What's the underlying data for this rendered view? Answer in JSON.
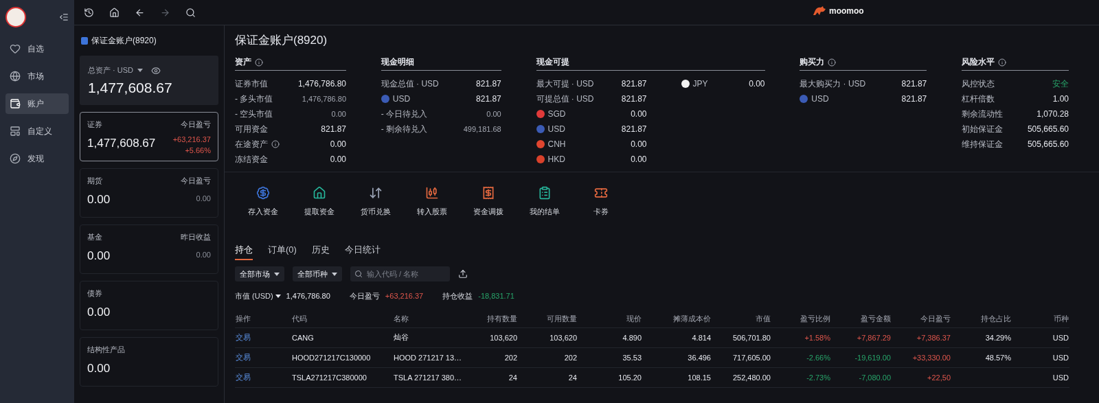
{
  "nav": {
    "items": [
      {
        "label": "自选",
        "selected": false
      },
      {
        "label": "市场",
        "selected": false
      },
      {
        "label": "账户",
        "selected": true
      },
      {
        "label": "自定义",
        "selected": false
      },
      {
        "label": "发现",
        "selected": false
      }
    ]
  },
  "topbar": {
    "logo": "moomoo"
  },
  "account_panel": {
    "title": "保证金账户(8920)",
    "total": {
      "label": "总资产 · USD",
      "value": "1,477,608.67"
    },
    "cards": [
      {
        "label": "证券",
        "value": "1,477,608.67",
        "pl_label": "今日盈亏",
        "pl_values": [
          {
            "text": "+63,216.37",
            "color": "#e0564c"
          },
          {
            "text": "+5.66%",
            "color": "#e0564c"
          }
        ],
        "selected": true
      },
      {
        "label": "期货",
        "value": "0.00",
        "pl_label": "今日盈亏",
        "pl_values": [
          {
            "text": "0.00",
            "color": "#8b8f99"
          }
        ],
        "selected": false
      },
      {
        "label": "基金",
        "value": "0.00",
        "pl_label": "昨日收益",
        "pl_values": [
          {
            "text": "0.00",
            "color": "#8b8f99"
          }
        ],
        "selected": false
      },
      {
        "label": "债券",
        "value": "0.00",
        "selected": false
      },
      {
        "label": "结构性产品",
        "value": "0.00",
        "selected": false
      }
    ]
  },
  "main": {
    "title": "保证金账户(8920)",
    "sections": [
      {
        "title": "资产",
        "info": true,
        "columns": [
          [
            {
              "label": "证券市值",
              "value": "1,476,786.80",
              "kind": "main"
            },
            {
              "label": "- 多头市值",
              "value": "1,476,786.80",
              "kind": "sub"
            },
            {
              "label": "- 空头市值",
              "value": "0.00",
              "kind": "sub"
            },
            {
              "label": "可用资金",
              "value": "821.87",
              "kind": "main"
            },
            {
              "label": "在途资产",
              "value": "0.00",
              "kind": "main",
              "info": true
            },
            {
              "label": "冻结资金",
              "value": "0.00",
              "kind": "main"
            }
          ]
        ]
      },
      {
        "title": "现金明细",
        "columns": [
          [
            {
              "label": "现金总值 · USD",
              "value": "821.87",
              "kind": "main"
            },
            {
              "label": "USD",
              "value": "821.87",
              "kind": "flag",
              "color": "#3b5bb5"
            },
            {
              "label": "- 今日待兑入",
              "value": "0.00",
              "kind": "sub"
            },
            {
              "label": "- 剩余待兑入",
              "value": "499,181.68",
              "kind": "sub"
            }
          ]
        ]
      },
      {
        "title": "现金可提",
        "columns": [
          [
            {
              "label": "最大可提 · USD",
              "value": "821.87",
              "kind": "main"
            },
            {
              "label": "可提总值 · USD",
              "value": "821.87",
              "kind": "main"
            },
            {
              "label": "SGD",
              "value": "0.00",
              "kind": "flag",
              "color": "#e03a3a"
            },
            {
              "label": "USD",
              "value": "821.87",
              "kind": "flag",
              "color": "#3b5bb5"
            },
            {
              "label": "CNH",
              "value": "0.00",
              "kind": "flag",
              "color": "#e0452f"
            },
            {
              "label": "HKD",
              "value": "0.00",
              "kind": "flag",
              "color": "#d9412b"
            }
          ],
          [
            {
              "label": "JPY",
              "value": "0.00",
              "kind": "flag",
              "color": "#f2f2f2"
            }
          ]
        ]
      },
      {
        "title": "购买力",
        "info": true,
        "columns": [
          [
            {
              "label": "最大购买力 · USD",
              "value": "821.87",
              "kind": "main"
            },
            {
              "label": "USD",
              "value": "821.87",
              "kind": "flag",
              "color": "#3b5bb5"
            }
          ]
        ]
      },
      {
        "title": "风险水平",
        "info": true,
        "columns": [
          [
            {
              "label": "风控状态",
              "value": "安全",
              "kind": "status",
              "color": "#27a56a"
            },
            {
              "label": "杠杆倍数",
              "value": "1.00",
              "kind": "main"
            },
            {
              "label": "剩余流动性",
              "value": "1,070.28",
              "kind": "main"
            },
            {
              "label": "初始保证金",
              "value": "505,665.60",
              "kind": "main"
            },
            {
              "label": "维持保证金",
              "value": "505,665.60",
              "kind": "main"
            }
          ]
        ]
      }
    ],
    "actions": [
      {
        "label": "存入资金",
        "color": "#3d74d9"
      },
      {
        "label": "提取资金",
        "color": "#26b59a"
      },
      {
        "label": "货币兑换",
        "color": "#9aa3b5"
      },
      {
        "label": "转入股票",
        "color": "#e3683f"
      },
      {
        "label": "资金调拨",
        "color": "#e3683f"
      },
      {
        "label": "我的结单",
        "color": "#26b59a"
      },
      {
        "label": "卡券",
        "color": "#e3683f"
      }
    ],
    "tabs": [
      {
        "label": "持仓",
        "selected": true
      },
      {
        "label": "订单(0)",
        "selected": false
      },
      {
        "label": "历史",
        "selected": false
      },
      {
        "label": "今日统计",
        "selected": false
      }
    ],
    "filters": {
      "dropdowns": [
        "全部市场",
        "全部币种"
      ],
      "search": {
        "placeholder": "输入代码 / 名称"
      }
    },
    "summary": [
      {
        "label": "市值 (USD)",
        "value": "1,476,786.80",
        "dropdown": true
      },
      {
        "label": "今日盈亏",
        "value": "+63,216.37",
        "color": "#e0564c"
      },
      {
        "label": "持仓收益",
        "value": "-18,831.71",
        "color": "#27a56a"
      }
    ],
    "table": {
      "columns": [
        "操作",
        "代码",
        "名称",
        "持有数量",
        "可用数量",
        "现价",
        "摊薄成本价",
        "市值",
        "盈亏比例",
        "盈亏金额",
        "今日盈亏",
        "持仓占比",
        "币种"
      ],
      "rows": [
        [
          {
            "text": "交易",
            "kind": "link"
          },
          {
            "text": "CANG"
          },
          {
            "text": "灿谷"
          },
          {
            "text": "103,620"
          },
          {
            "text": "103,620"
          },
          {
            "text": "4.890"
          },
          {
            "text": "4.814"
          },
          {
            "text": "506,701.80"
          },
          {
            "text": "+1.58%",
            "color": "#e0564c"
          },
          {
            "text": "+7,867.29",
            "color": "#e0564c"
          },
          {
            "text": "+7,386.37",
            "color": "#e0564c"
          },
          {
            "text": "34.29%"
          },
          {
            "text": "USD"
          }
        ],
        [
          {
            "text": "交易",
            "kind": "link"
          },
          {
            "text": "HOOD271217C130000"
          },
          {
            "text": "HOOD 271217 13…"
          },
          {
            "text": "202"
          },
          {
            "text": "202"
          },
          {
            "text": "35.53"
          },
          {
            "text": "36.496"
          },
          {
            "text": "717,605.00"
          },
          {
            "text": "-2.66%",
            "color": "#27a56a"
          },
          {
            "text": "-19,619.00",
            "color": "#27a56a"
          },
          {
            "text": "+33,330.00",
            "color": "#e0564c"
          },
          {
            "text": "48.57%"
          },
          {
            "text": "USD"
          }
        ],
        [
          {
            "text": "交易",
            "kind": "link"
          },
          {
            "text": "TSLA271217C380000"
          },
          {
            "text": "TSLA 271217 380…"
          },
          {
            "text": "24"
          },
          {
            "text": "24"
          },
          {
            "text": "105.20"
          },
          {
            "text": "108.15"
          },
          {
            "text": "252,480.00"
          },
          {
            "text": "-2.73%",
            "color": "#27a56a"
          },
          {
            "text": "-7,080.00",
            "color": "#27a56a"
          },
          {
            "text": "+22,50",
            "color": "#e0564c"
          },
          {},
          {
            "text": "USD"
          }
        ]
      ]
    }
  }
}
